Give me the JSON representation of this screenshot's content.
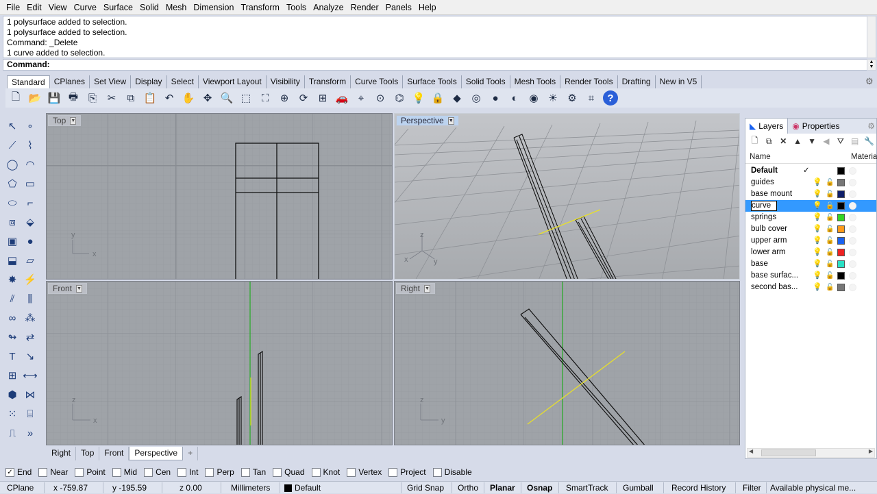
{
  "menu": [
    "File",
    "Edit",
    "View",
    "Curve",
    "Surface",
    "Solid",
    "Mesh",
    "Dimension",
    "Transform",
    "Tools",
    "Analyze",
    "Render",
    "Panels",
    "Help"
  ],
  "history": [
    "1 polysurface added to selection.",
    "1 polysurface added to selection.",
    "Command: _Delete",
    "1 curve added to selection."
  ],
  "command": {
    "prompt": "Command:"
  },
  "toolbar_tabs": [
    "Standard",
    "CPlanes",
    "Set View",
    "Display",
    "Select",
    "Viewport Layout",
    "Visibility",
    "Transform",
    "Curve Tools",
    "Surface Tools",
    "Solid Tools",
    "Mesh Tools",
    "Render Tools",
    "Drafting",
    "New in V5"
  ],
  "toolbar_icons": [
    "new-file-icon",
    "open-icon",
    "save-icon",
    "print-icon",
    "import-icon",
    "cut-icon",
    "copy-icon",
    "paste-icon",
    "undo-icon",
    "pan-icon",
    "rotate-view-icon",
    "zoom-icon",
    "zoom-window-icon",
    "zoom-extents-icon",
    "zoom-selected-icon",
    "rotate-icon",
    "four-viewports-icon",
    "car-icon",
    "select-icon",
    "cplane-icon",
    "osnap-icon",
    "light-icon",
    "lock-icon",
    "layer-color-icon",
    "color-wheel-icon",
    "render-preview-icon",
    "render-shaded-icon",
    "render-icon",
    "sun-icon",
    "options-icon",
    "history-icon",
    "help-icon"
  ],
  "viewports": {
    "top": {
      "label": "Top",
      "axis1": "y",
      "axis2": "x"
    },
    "perspective": {
      "label": "Perspective",
      "axis1": "z",
      "axis2": "x",
      "axis3": "y"
    },
    "front": {
      "label": "Front",
      "axis1": "z",
      "axis2": "x"
    },
    "right": {
      "label": "Right",
      "axis1": "z",
      "axis2": "y"
    }
  },
  "viewport_tabs": [
    "Right",
    "Top",
    "Front",
    "Perspective"
  ],
  "viewport_tab_add": "+",
  "panel": {
    "tabs": [
      "Layers",
      "Properties"
    ],
    "columns": {
      "name": "Name",
      "material": "Material"
    },
    "layers": [
      {
        "name": "Default",
        "current": "✓",
        "color": "#000000"
      },
      {
        "name": "guides",
        "color": "#777777"
      },
      {
        "name": "base mount",
        "color": "#0f1f6a"
      },
      {
        "name": "curve",
        "color": "#000000",
        "selected": true
      },
      {
        "name": "springs",
        "color": "#33d624"
      },
      {
        "name": "bulb cover",
        "color": "#ff9a1a"
      },
      {
        "name": "upper arm",
        "color": "#1a62f0"
      },
      {
        "name": "lower arm",
        "color": "#ee2222"
      },
      {
        "name": "base",
        "color": "#29e0c4"
      },
      {
        "name": "base surfac...",
        "color": "#000000"
      },
      {
        "name": "second bas...",
        "color": "#777777"
      }
    ]
  },
  "osnap": [
    {
      "label": "End",
      "checked": true
    },
    {
      "label": "Near",
      "checked": false
    },
    {
      "label": "Point",
      "checked": false
    },
    {
      "label": "Mid",
      "checked": false
    },
    {
      "label": "Cen",
      "checked": false
    },
    {
      "label": "Int",
      "checked": false
    },
    {
      "label": "Perp",
      "checked": false
    },
    {
      "label": "Tan",
      "checked": false
    },
    {
      "label": "Quad",
      "checked": false
    },
    {
      "label": "Knot",
      "checked": false
    },
    {
      "label": "Vertex",
      "checked": false
    },
    {
      "label": "Project",
      "checked": false
    },
    {
      "label": "Disable",
      "checked": false
    }
  ],
  "status": {
    "cplane": "CPlane",
    "x": "x -759.87",
    "y": "y -195.59",
    "z": "z 0.00",
    "units": "Millimeters",
    "layer": "Default",
    "grid_snap": "Grid Snap",
    "ortho": "Ortho",
    "planar": "Planar",
    "osnap": "Osnap",
    "smarttrack": "SmartTrack",
    "gumball": "Gumball",
    "record_history": "Record History",
    "filter": "Filter",
    "message": "Available physical me..."
  },
  "colors": {
    "grid_bg": "#9fa3a8",
    "accent_blue": "#3399ff",
    "highlight_yellow": "#e8e02a",
    "green_axis": "#22aa22"
  }
}
